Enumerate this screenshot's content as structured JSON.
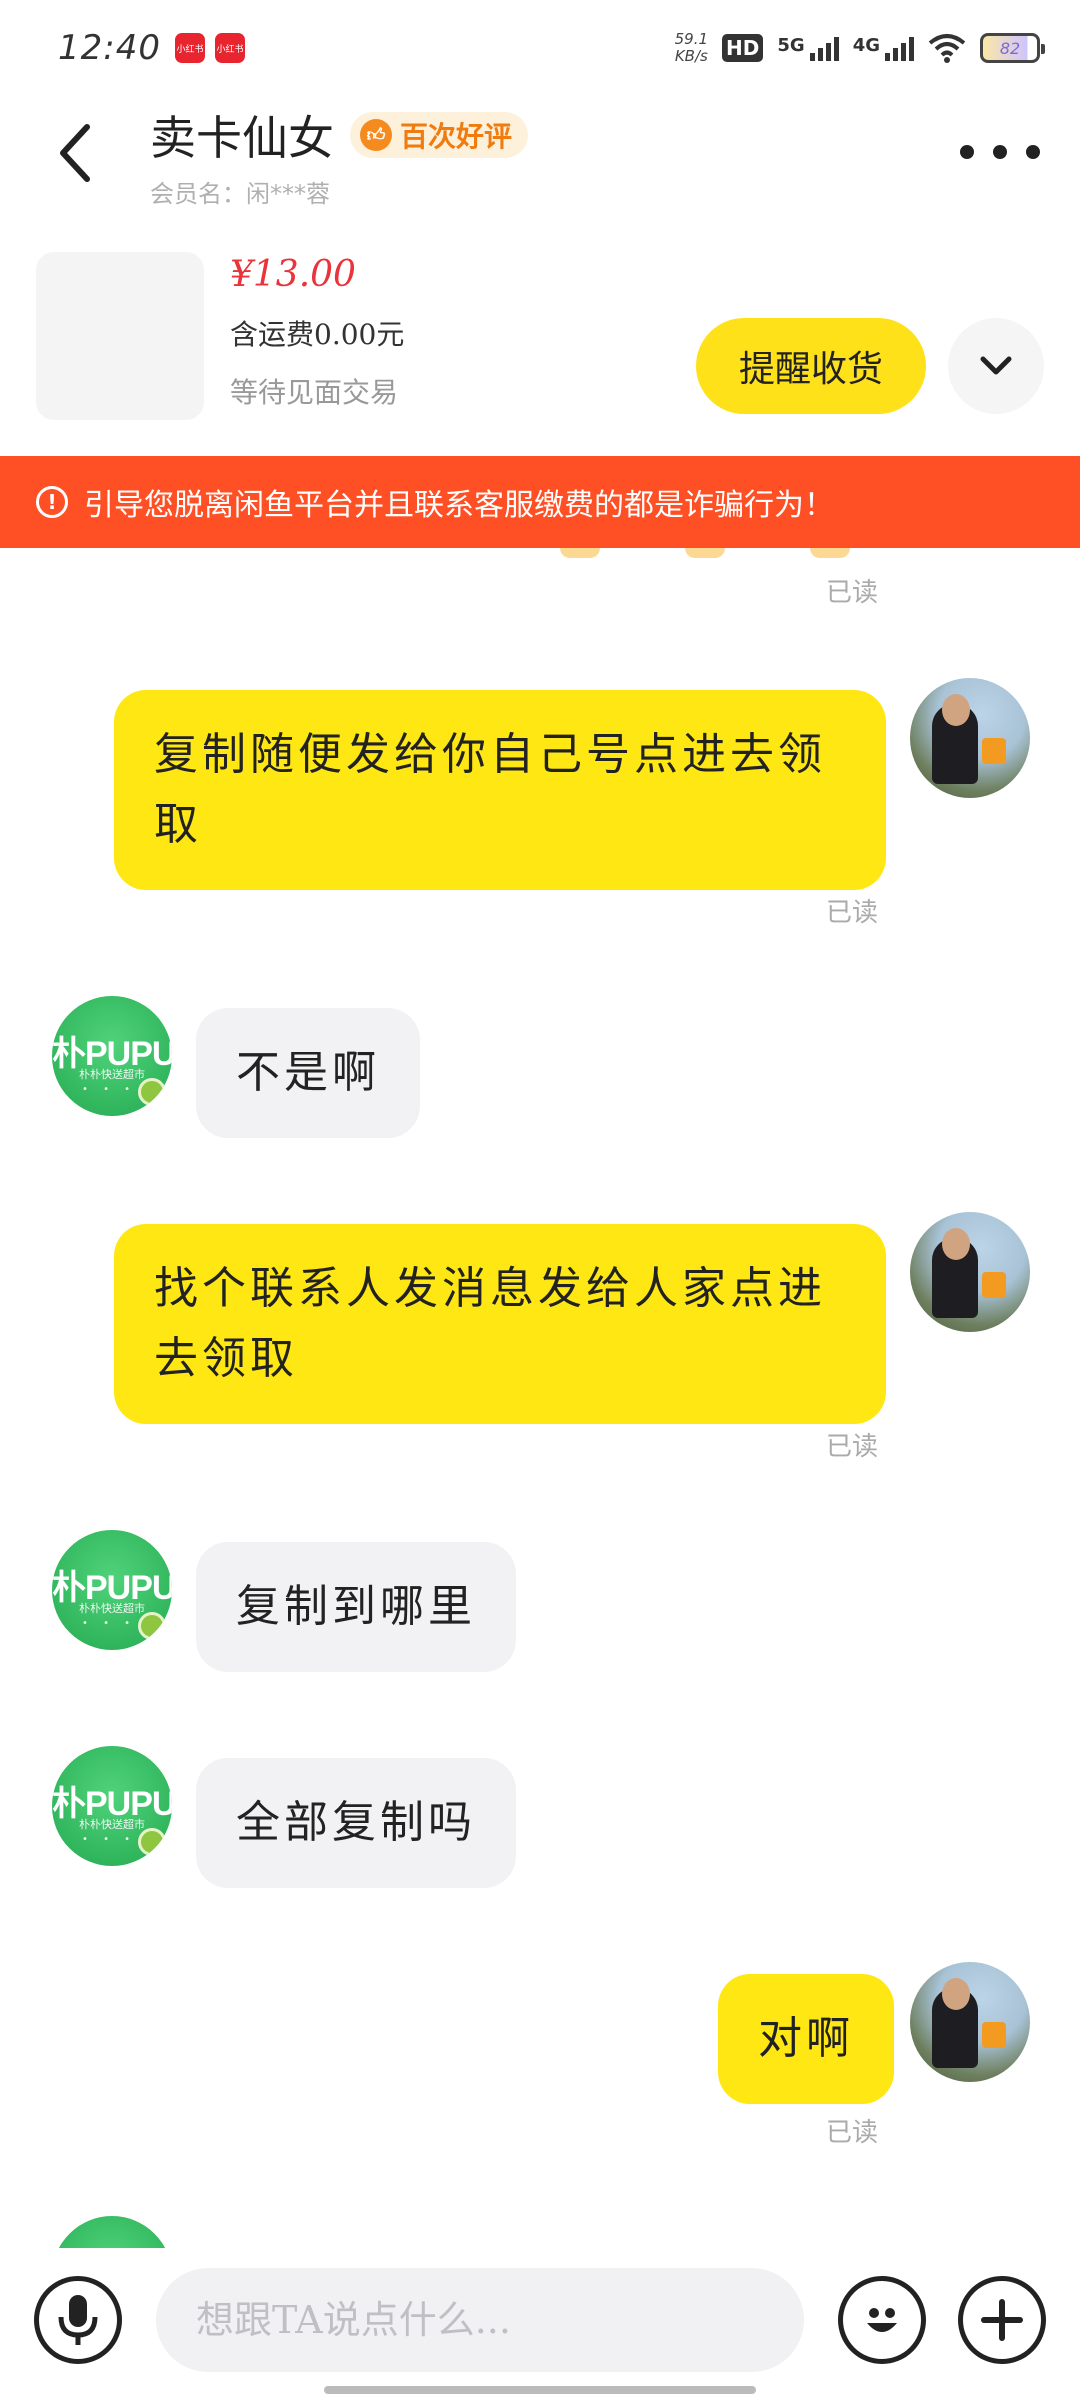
{
  "status_bar": {
    "time": "12:40",
    "notification_badges": [
      "小红书",
      "小红书"
    ],
    "net_speed": "59.1",
    "net_unit": "KB/s",
    "hd": "HD",
    "signal_1": "5G",
    "signal_2": "4G",
    "battery": "82"
  },
  "header": {
    "seller_name": "卖卡仙女",
    "rating_badge": "百次好评",
    "member_name": "会员名：闲***蓉"
  },
  "product": {
    "price": "¥13.00",
    "shipping": "含运费0.00元",
    "status": "等待见面交易",
    "remind_button": "提醒收货"
  },
  "warning": {
    "text": "引导您脱离闲鱼平台并且联系客服缴费的都是诈骗行为！"
  },
  "messages": [
    {
      "sender": "me",
      "text": "复制随便发给你自己号点进去领取",
      "read": "已读"
    },
    {
      "sender": "them",
      "text": "不是啊"
    },
    {
      "sender": "me",
      "text": "找个联系人发消息发给人家点进去领取",
      "read": "已读"
    },
    {
      "sender": "them",
      "text": "复制到哪里"
    },
    {
      "sender": "them",
      "text": "全部复制吗"
    },
    {
      "sender": "me",
      "text": "对啊",
      "read": "已读"
    }
  ],
  "top_read_label": "已读",
  "avatar_them": {
    "brand": "朴PUPU",
    "sub": "朴朴快送超市"
  },
  "input": {
    "placeholder": "想跟TA说点什么..."
  },
  "colors": {
    "accent_yellow": "#ffe713",
    "warning_red": "#ff5025",
    "price_red": "#e8343a",
    "badge_orange": "#f07c10"
  },
  "icons": [
    "back-arrow-icon",
    "more-icon",
    "chevron-down-icon",
    "warning-icon",
    "microphone-icon",
    "emoji-icon",
    "plus-icon"
  ]
}
